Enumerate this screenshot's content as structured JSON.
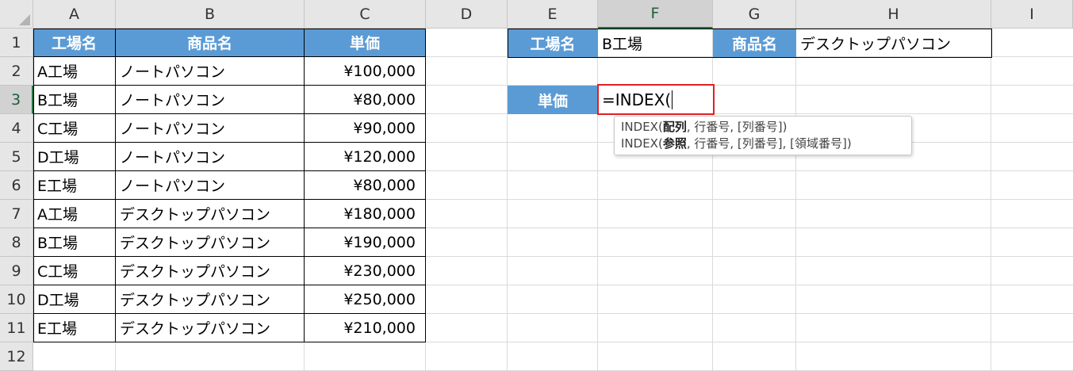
{
  "columns": [
    "A",
    "B",
    "C",
    "D",
    "E",
    "F",
    "G",
    "H",
    "I"
  ],
  "selected_column": "F",
  "rows": [
    "1",
    "2",
    "3",
    "4",
    "5",
    "6",
    "7",
    "8",
    "9",
    "10",
    "11",
    "12"
  ],
  "selected_row": "3",
  "table": {
    "headers": [
      "工場名",
      "商品名",
      "単価"
    ],
    "rows": [
      [
        "A工場",
        "ノートパソコン",
        "¥100,000"
      ],
      [
        "B工場",
        "ノートパソコン",
        "¥80,000"
      ],
      [
        "C工場",
        "ノートパソコン",
        "¥90,000"
      ],
      [
        "D工場",
        "ノートパソコン",
        "¥120,000"
      ],
      [
        "E工場",
        "ノートパソコン",
        "¥80,000"
      ],
      [
        "A工場",
        "デスクトップパソコン",
        "¥180,000"
      ],
      [
        "B工場",
        "デスクトップパソコン",
        "¥190,000"
      ],
      [
        "C工場",
        "デスクトップパソコン",
        "¥230,000"
      ],
      [
        "D工場",
        "デスクトップパソコン",
        "¥250,000"
      ],
      [
        "E工場",
        "デスクトップパソコン",
        "¥210,000"
      ]
    ]
  },
  "lookup": {
    "factory_label": "工場名",
    "factory_value": "B工場",
    "product_label": "商品名",
    "product_value": "デスクトップパソコン",
    "price_label": "単価",
    "formula_input": "=INDEX("
  },
  "tooltip": {
    "line1_fn": "INDEX(",
    "line1_bold": "配列",
    "line1_rest": ", 行番号, [列番号])",
    "line2_fn": "INDEX(",
    "line2_bold": "参照",
    "line2_rest": ", 行番号, [列番号], [領域番号])"
  },
  "colors": {
    "header_fill": "#5b9bd5",
    "active_border": "#e02020",
    "selected_header_accent": "#217346"
  }
}
